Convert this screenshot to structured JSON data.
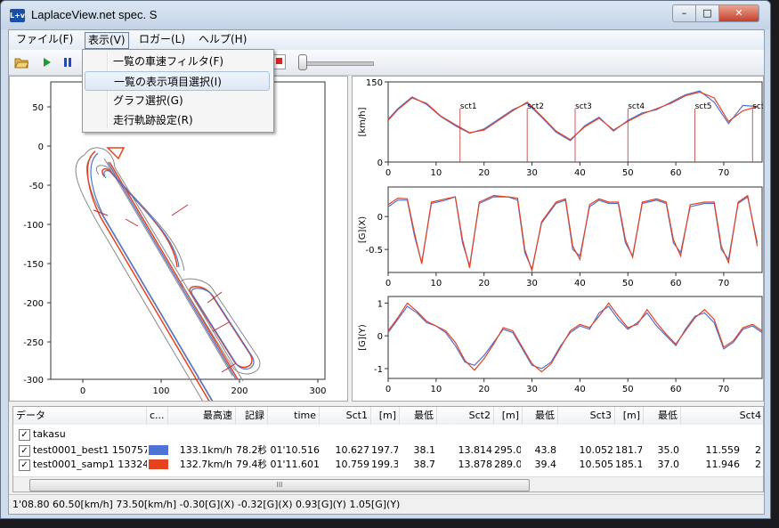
{
  "window": {
    "title": "LaplaceView.net spec. S",
    "logo_text": "L+v",
    "min_glyph": "–",
    "max_glyph": "□",
    "close_glyph": "✕"
  },
  "menubar": {
    "file": "ファイル(F)",
    "view": "表示(V)",
    "logger": "ロガー(L)",
    "help": "ヘルプ(H)"
  },
  "view_menu": {
    "items": [
      "一覧の車速フィルタ(F)",
      "一覧の表示項目選択(I)",
      "グラフ選択(G)",
      "走行軌跡設定(R)"
    ]
  },
  "map": {
    "x_ticks": [
      "0",
      "100",
      "200",
      "300"
    ],
    "y_ticks": [
      "50",
      "0",
      "-50",
      "-100",
      "-150",
      "-200",
      "-250",
      "-300"
    ]
  },
  "chart_data": [
    {
      "type": "line",
      "ylabel": "[km/h]",
      "y_ticks": [
        "150",
        "0"
      ],
      "x_ticks": [
        "0",
        "10",
        "20",
        "30",
        "40",
        "50",
        "60",
        "70"
      ],
      "xlim": [
        0,
        78
      ],
      "ylim": [
        0,
        150
      ],
      "series": [
        {
          "name": "test0001_best1 150757",
          "color": "#4f73d4",
          "x": [
            0,
            2,
            5,
            8,
            11,
            14,
            17,
            20,
            23,
            26,
            29,
            32,
            35,
            38,
            41,
            44,
            47,
            50,
            53,
            56,
            59,
            62,
            65,
            68,
            71,
            74,
            77
          ],
          "values": [
            80,
            100,
            122,
            108,
            85,
            68,
            54,
            62,
            80,
            98,
            110,
            84,
            56,
            40,
            68,
            84,
            58,
            78,
            92,
            98,
            112,
            126,
            133,
            112,
            72,
            106,
            104
          ]
        },
        {
          "name": "test0001_samp1 133243",
          "color": "#e5421f",
          "x": [
            0,
            2,
            5,
            8,
            11,
            14,
            17,
            20,
            23,
            26,
            29,
            32,
            35,
            38,
            41,
            44,
            47,
            50,
            53,
            56,
            59,
            62,
            65,
            68,
            71,
            74,
            77
          ],
          "values": [
            78,
            98,
            120,
            110,
            86,
            70,
            55,
            60,
            78,
            96,
            112,
            86,
            58,
            42,
            66,
            82,
            60,
            76,
            90,
            100,
            110,
            124,
            131,
            120,
            76,
            96,
            104
          ]
        }
      ],
      "annotations": [
        "sct1",
        "sct2",
        "sct3",
        "sct4",
        "sct5",
        "sct6"
      ]
    },
    {
      "type": "line",
      "ylabel": "[G](X)",
      "y_ticks": [
        "0",
        "-0.5"
      ],
      "x_ticks": [
        "0",
        "10",
        "20",
        "30",
        "40",
        "50",
        "60",
        "70"
      ],
      "xlim": [
        0,
        78
      ],
      "ylim": [
        -0.85,
        0.45
      ],
      "series": [
        {
          "name": "test0001_best1 150757",
          "color": "#4f73d4",
          "x": [
            0,
            2,
            4,
            5.5,
            7,
            9,
            12,
            14,
            15.5,
            17,
            19,
            22,
            25,
            27,
            28.5,
            30,
            32,
            35,
            37,
            38.5,
            40,
            42,
            44,
            46,
            48,
            49.5,
            51,
            53,
            56,
            58,
            59.5,
            61,
            63,
            66,
            68,
            69.5,
            71,
            73,
            75,
            77
          ],
          "values": [
            0.15,
            0.25,
            0.25,
            -0.3,
            -0.7,
            0.2,
            0.25,
            0.3,
            -0.4,
            -0.75,
            0.2,
            0.3,
            0.3,
            0.25,
            -0.55,
            -0.8,
            -0.1,
            0.2,
            0.25,
            -0.5,
            -0.6,
            0.15,
            0.25,
            0.2,
            0.2,
            -0.4,
            -0.6,
            0.2,
            0.25,
            0.2,
            -0.4,
            -0.55,
            0.15,
            0.2,
            0.2,
            -0.5,
            -0.65,
            0.2,
            0.3,
            -0.4
          ]
        },
        {
          "name": "test0001_samp1 133243",
          "color": "#e5421f",
          "x": [
            0,
            2,
            4,
            5.5,
            7,
            9,
            12,
            14,
            15.5,
            17,
            19,
            22,
            25,
            27,
            28.5,
            30,
            32,
            35,
            37,
            38.5,
            40,
            42,
            44,
            46,
            48,
            49.5,
            51,
            53,
            56,
            58,
            59.5,
            61,
            63,
            66,
            68,
            69.5,
            71,
            73,
            75,
            77
          ],
          "values": [
            0.18,
            0.28,
            0.27,
            -0.25,
            -0.72,
            0.22,
            0.27,
            0.3,
            -0.35,
            -0.78,
            0.22,
            0.32,
            0.3,
            0.28,
            -0.5,
            -0.82,
            -0.08,
            0.22,
            0.27,
            -0.45,
            -0.65,
            0.18,
            0.27,
            0.22,
            0.22,
            -0.35,
            -0.62,
            0.22,
            0.27,
            0.22,
            -0.35,
            -0.6,
            0.18,
            0.22,
            0.22,
            -0.45,
            -0.7,
            0.22,
            0.32,
            -0.45
          ]
        }
      ]
    },
    {
      "type": "line",
      "ylabel": "[G](Y)",
      "y_ticks": [
        "1",
        "0",
        "-1"
      ],
      "x_ticks": [
        "0",
        "10",
        "20",
        "30",
        "40",
        "50",
        "60",
        "70"
      ],
      "xlim": [
        0,
        78
      ],
      "ylim": [
        -1.3,
        1.2
      ],
      "series": [
        {
          "name": "test0001_best1 150757",
          "color": "#4f73d4",
          "x": [
            0,
            2,
            4,
            6,
            8,
            10,
            12,
            14,
            16,
            18,
            20,
            22,
            24,
            26,
            28,
            30,
            32,
            34,
            36,
            38,
            40,
            42,
            44,
            46,
            48,
            50,
            52,
            54,
            56,
            58,
            60,
            62,
            64,
            66,
            68,
            70,
            72,
            74,
            76,
            78
          ],
          "values": [
            0.1,
            0.5,
            0.9,
            0.7,
            0.4,
            0.3,
            0.1,
            -0.3,
            -0.8,
            -0.9,
            -0.6,
            -0.2,
            0.2,
            0.1,
            -0.4,
            -0.9,
            -1.0,
            -0.8,
            -0.3,
            0.1,
            0.3,
            0.2,
            0.7,
            0.9,
            0.5,
            0.2,
            0.4,
            0.7,
            0.3,
            0.0,
            -0.3,
            0.2,
            0.6,
            0.7,
            0.4,
            -0.4,
            -0.2,
            0.2,
            0.3,
            0.1
          ]
        },
        {
          "name": "test0001_samp1 133243",
          "color": "#e5421f",
          "x": [
            0,
            2,
            4,
            6,
            8,
            10,
            12,
            14,
            16,
            18,
            20,
            22,
            24,
            26,
            28,
            30,
            32,
            34,
            36,
            38,
            40,
            42,
            44,
            46,
            48,
            50,
            52,
            54,
            56,
            58,
            60,
            62,
            64,
            66,
            68,
            70,
            72,
            74,
            76,
            78
          ],
          "values": [
            0.15,
            0.55,
            1.0,
            0.75,
            0.45,
            0.3,
            0.15,
            -0.2,
            -0.75,
            -1.05,
            -0.7,
            -0.25,
            0.25,
            0.15,
            -0.35,
            -0.85,
            -1.1,
            -0.85,
            -0.35,
            0.15,
            0.35,
            0.25,
            0.6,
            1.0,
            0.6,
            0.25,
            0.35,
            0.8,
            0.4,
            0.05,
            -0.25,
            0.15,
            0.55,
            0.8,
            0.5,
            -0.35,
            -0.15,
            0.25,
            0.35,
            0.15
          ]
        }
      ]
    }
  ],
  "table": {
    "headers": [
      "データ",
      "c...",
      "最高速",
      "記録",
      "time",
      "Sct1",
      "[m]",
      "最低",
      "Sct2",
      "[m]",
      "最低",
      "Sct3",
      "[m]",
      "最低",
      "Sct4"
    ],
    "group_row": "takasu",
    "rows": [
      {
        "name": "test0001_best1 150757",
        "color": "#4f73d4",
        "cells": [
          "133.1km/h",
          "78.2秒",
          "01'10.516",
          "10.627",
          "197.7",
          "38.1",
          "13.814",
          "295.0",
          "43.8",
          "10.052",
          "181.7",
          "35.0",
          "11.559",
          "2"
        ]
      },
      {
        "name": "test0001_samp1 133243",
        "color": "#e5421f",
        "cells": [
          "132.7km/h",
          "79.4秒",
          "01'11.601",
          "10.759",
          "199.3",
          "38.7",
          "13.878",
          "289.0",
          "39.4",
          "10.505",
          "185.1",
          "37.0",
          "11.946",
          "2"
        ]
      }
    ],
    "scroll_glyph": "III"
  },
  "status": "1'08.80 60.50[km/h] 73.50[km/h]  -0.30[G](X) -0.32[G](X)  0.93[G](Y) 1.05[G](Y)"
}
